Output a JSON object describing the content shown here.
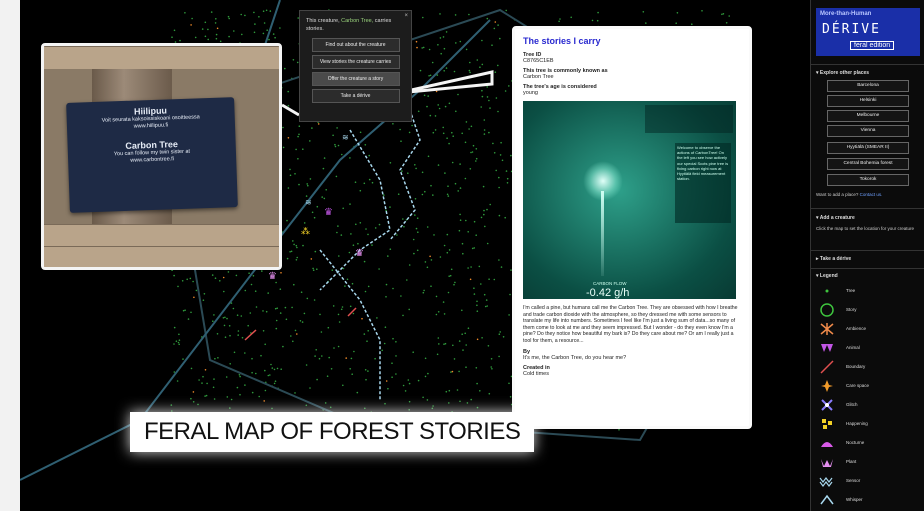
{
  "photo": {
    "sign_title_1": "Hiilipuu",
    "sign_line_1": "Voit seurata kaksoissiskoani osoitteessa",
    "sign_line_2": "www.hiilipuu.fi",
    "sign_title_2": "Carbon Tree",
    "sign_line_3": "You can follow my twin sister at",
    "sign_line_4": "www.carbontree.fi"
  },
  "popup": {
    "text_prefix": "This creature,",
    "creature_name": "Carbon Tree,",
    "text_suffix": "carries stories.",
    "close": "×",
    "buttons": [
      "Find out about the creature",
      "View stories the creature carries",
      "Offer the creature a story",
      "Take a dérive"
    ]
  },
  "stories": {
    "title": "The stories I carry",
    "tree_id_label": "Tree ID",
    "tree_id_value": "C8765C1EB",
    "known_label": "This tree is commonly known as",
    "known_value": "Carbon Tree",
    "age_label": "The tree's age is considered",
    "age_value": "young",
    "image_side_text": "Welcome to observe the actions of CarbonTree! On the left you see how actively our special Scots pine tree is fixing carbon right now at Hyytiälä field measurement station.",
    "flow_label": "CARBON FLOW",
    "flow_value": "-0.42 g/h",
    "story_text": "I'm called a pine, but humans call me the Carbon Tree. They are obsessed with how I breathe and trade carbon dioxide with the atmosphere, so they dressed me with some sensors to translate my life into numbers. Sometimes I feel like I'm just a living sum of data...so many of them come to look at me and they seem impressed. But I wonder - do they even know I'm a pine? Do they notice how beautiful my bark is? Do they care about me? Or am I really just a tool for them, a resource...",
    "by_label": "By",
    "by_value": "It's me, the Carbon Tree, do you hear me?",
    "created_label": "Created in",
    "created_value": "Cold times"
  },
  "map_title": "FERAL MAP OF FOREST STORIES",
  "sidebar": {
    "logo_line1": "More-than-Human",
    "logo_line2": "DÉRIVE",
    "logo_line3": "feral edition",
    "explore_header": "▾ Explore other places",
    "places": [
      "Barcelona",
      "Helsinki",
      "Melbourne",
      "Vienna",
      "Hyytiälä (SMEAR II)",
      "Central Bohemia forest",
      "Tokorok"
    ],
    "add_place_text": "Want to add a place?",
    "add_place_link": "Contact us.",
    "add_creature_header": "▾ Add a creature",
    "add_creature_text": "Click the map to set the location for your creature",
    "derive_header": "▸ Take a dérive",
    "legend_header": "▾ Legend",
    "legend": [
      "Tree",
      "Story",
      "Ambience",
      "Animal",
      "Boundary",
      "Care space",
      "Glitch",
      "Happening",
      "Nocturne",
      "Plant",
      "Sensor",
      "Whisper"
    ]
  },
  "colors": {
    "story_green": "#3ec43e",
    "link_blue": "#2a2ad0",
    "path_blue": "#a8d8ee"
  }
}
